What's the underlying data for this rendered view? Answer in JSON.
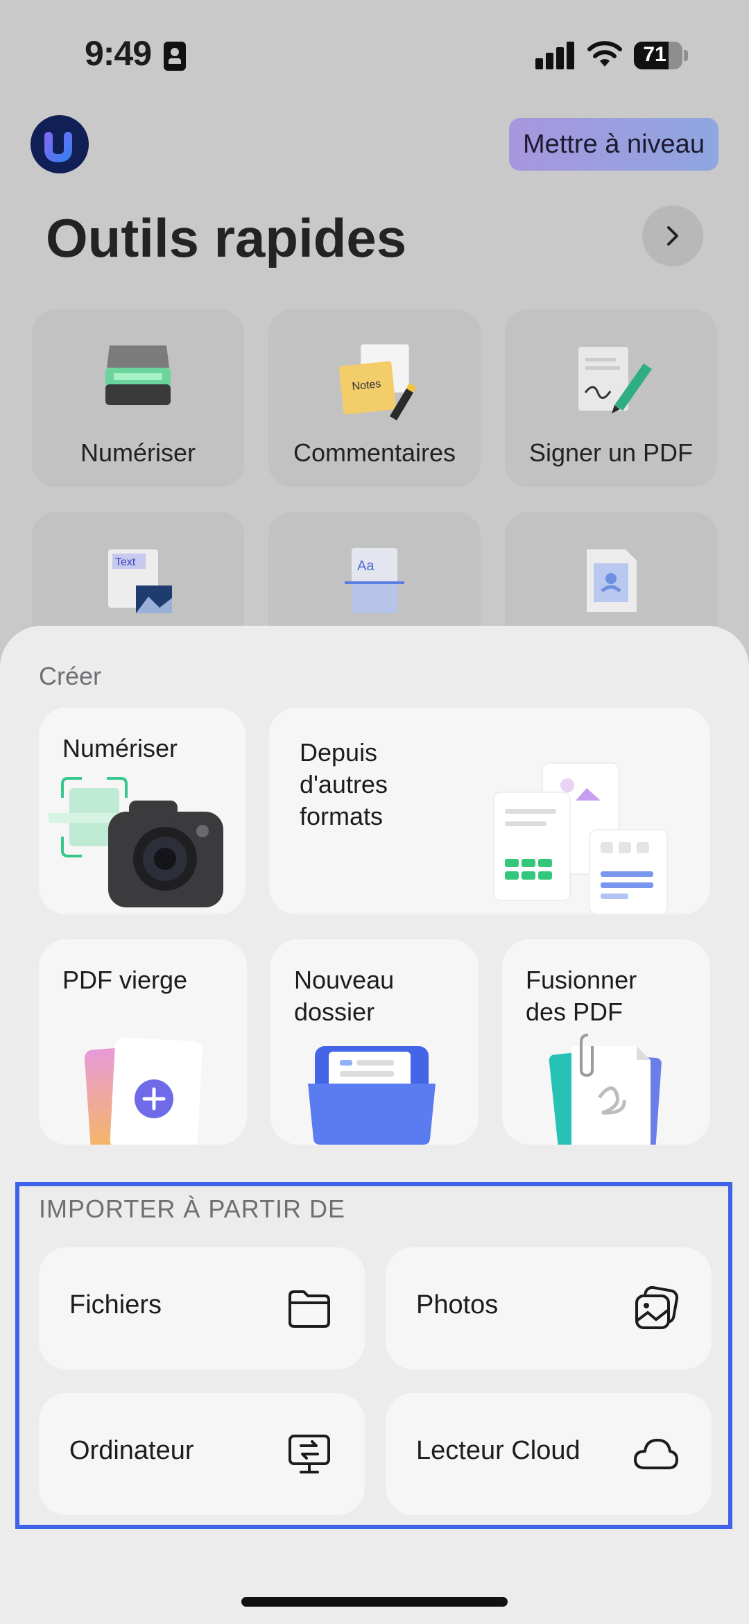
{
  "status_bar": {
    "time": "9:49",
    "battery": "71",
    "battery_level": 0.71
  },
  "header": {
    "upgrade_label": "Mettre à niveau",
    "title": "Outils rapides"
  },
  "quick_tools": [
    {
      "label": "Numériser",
      "icon": "scanner-icon"
    },
    {
      "label": "Commentaires",
      "icon": "notes-icon"
    },
    {
      "label": "Signer un PDF",
      "icon": "signature-pen-icon"
    },
    {
      "label": "",
      "icon": "text-image-icon"
    },
    {
      "label": "",
      "icon": "ocr-text-icon"
    },
    {
      "label": "",
      "icon": "image-document-icon"
    }
  ],
  "create": {
    "section_label": "Créer",
    "scan_label": "Numériser",
    "other_formats_label": "Depuis\nd'autres\nformats",
    "blank_pdf_label": "PDF vierge",
    "new_folder_label": "Nouveau\ndossier",
    "merge_label": "Fusionner\ndes PDF"
  },
  "import": {
    "section_label": "IMPORTER À PARTIR DE",
    "files_label": "Fichiers",
    "photos_label": "Photos",
    "computer_label": "Ordinateur",
    "cloud_label": "Lecteur Cloud"
  },
  "colors": {
    "accent": "#3e63e8",
    "upgrade_start": "#a796de",
    "upgrade_end": "#8fa6e0",
    "green": "#34c77b"
  },
  "text_samples": {
    "text_tag": "Text",
    "notes_tag": "Notes",
    "aa_tag": "Aa"
  }
}
